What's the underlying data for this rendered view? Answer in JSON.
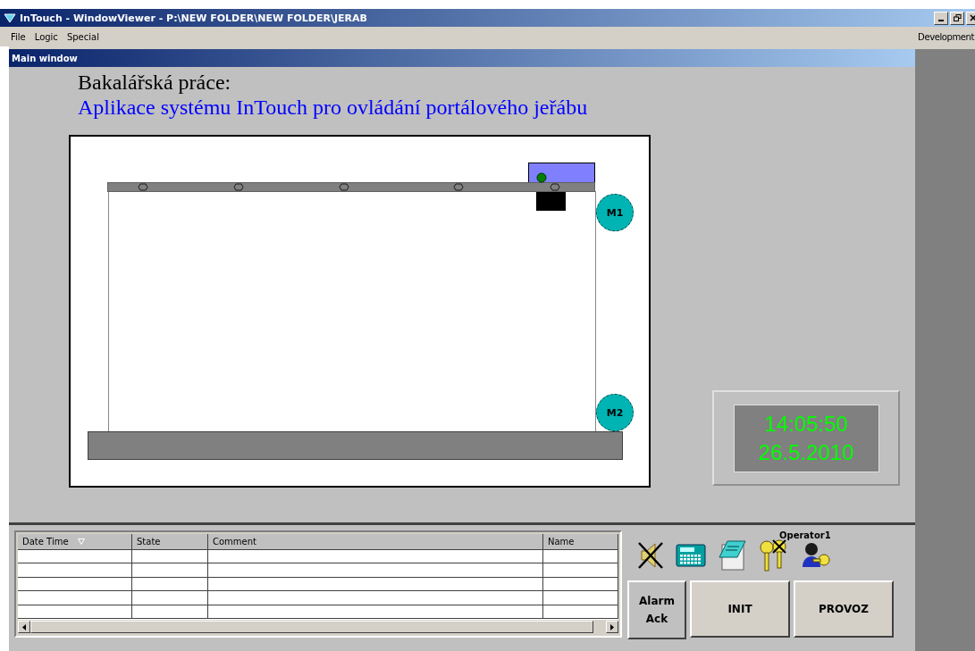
{
  "window": {
    "title": "InTouch - WindowViewer - P:\\NEW FOLDER\\NEW FOLDER\\JERAB"
  },
  "menu": [
    "File",
    "Logic",
    "Special"
  ],
  "menu_right": "Development",
  "main_window": {
    "title": "Main window",
    "heading": "Bakalářská práce:",
    "subheading": "Aplikace systému InTouch pro ovládání portálového jeřábu"
  },
  "crane": {
    "motors": [
      "M1",
      "M2"
    ]
  },
  "clock": {
    "time": "14:05:50",
    "date": "26.5.2010"
  },
  "alarm_table": {
    "columns": [
      {
        "label": "Date Time",
        "sorted": true
      },
      {
        "label": "State",
        "sorted": false
      },
      {
        "label": "Comment",
        "sorted": false
      },
      {
        "label": "Name",
        "sorted": false
      }
    ]
  },
  "operator": "Operator1",
  "buttons": [
    {
      "label": "Alarm Ack",
      "kind": "small"
    },
    {
      "label": "INIT",
      "kind": "large"
    },
    {
      "label": "PROVOZ",
      "kind": "large"
    }
  ]
}
